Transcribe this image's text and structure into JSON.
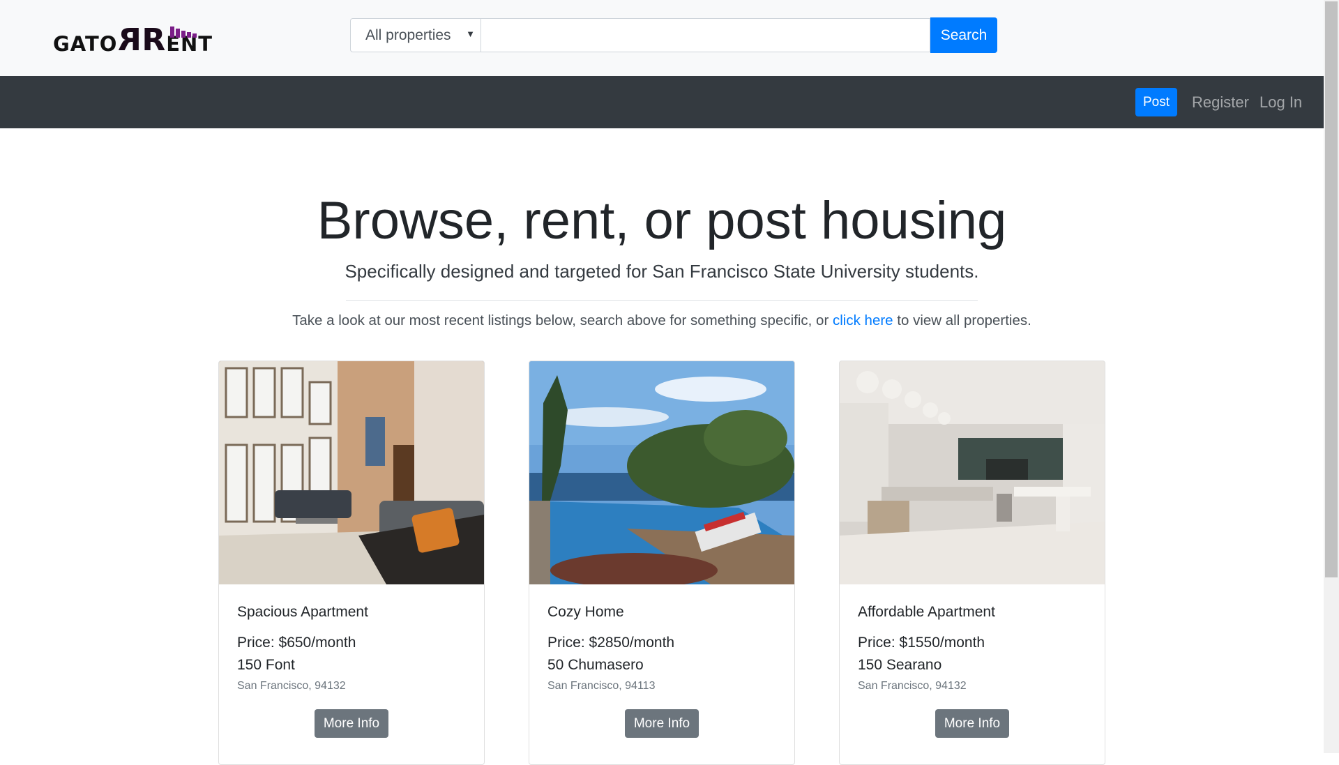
{
  "brand": {
    "logo_text_left": "GATO",
    "logo_text_mid": "RR",
    "logo_text_right": "ENT",
    "accent": "#7b1e88"
  },
  "search": {
    "category_selected": "All properties",
    "input_value": "",
    "button_label": "Search"
  },
  "nav": {
    "post_label": "Post",
    "register_label": "Register",
    "login_label": "Log In"
  },
  "hero": {
    "title": "Browse, rent, or post housing",
    "subtitle": "Specifically designed and targeted for San Francisco State University students.",
    "lead_before": "Take a look at our most recent listings below, search above for something specific, or ",
    "lead_link": "click here",
    "lead_after": " to view all properties."
  },
  "listings": [
    {
      "title": "Spacious Apartment",
      "price": "Price: $650/month",
      "street": "150 Font",
      "city": "San Francisco, 94132",
      "button_label": "More Info",
      "image": "living-room-photo"
    },
    {
      "title": "Cozy Home",
      "price": "Price: $2850/month",
      "street": "50 Chumasero",
      "city": "San Francisco, 94113",
      "button_label": "More Info",
      "image": "infinity-pool-photo"
    },
    {
      "title": "Affordable Apartment",
      "price": "Price: $1550/month",
      "street": "150 Searano",
      "city": "San Francisco, 94132",
      "button_label": "More Info",
      "image": "kitchen-interior-photo"
    }
  ],
  "colors": {
    "primary": "#007bff",
    "navbar": "#343a40",
    "secondary_button": "#6c757d"
  }
}
